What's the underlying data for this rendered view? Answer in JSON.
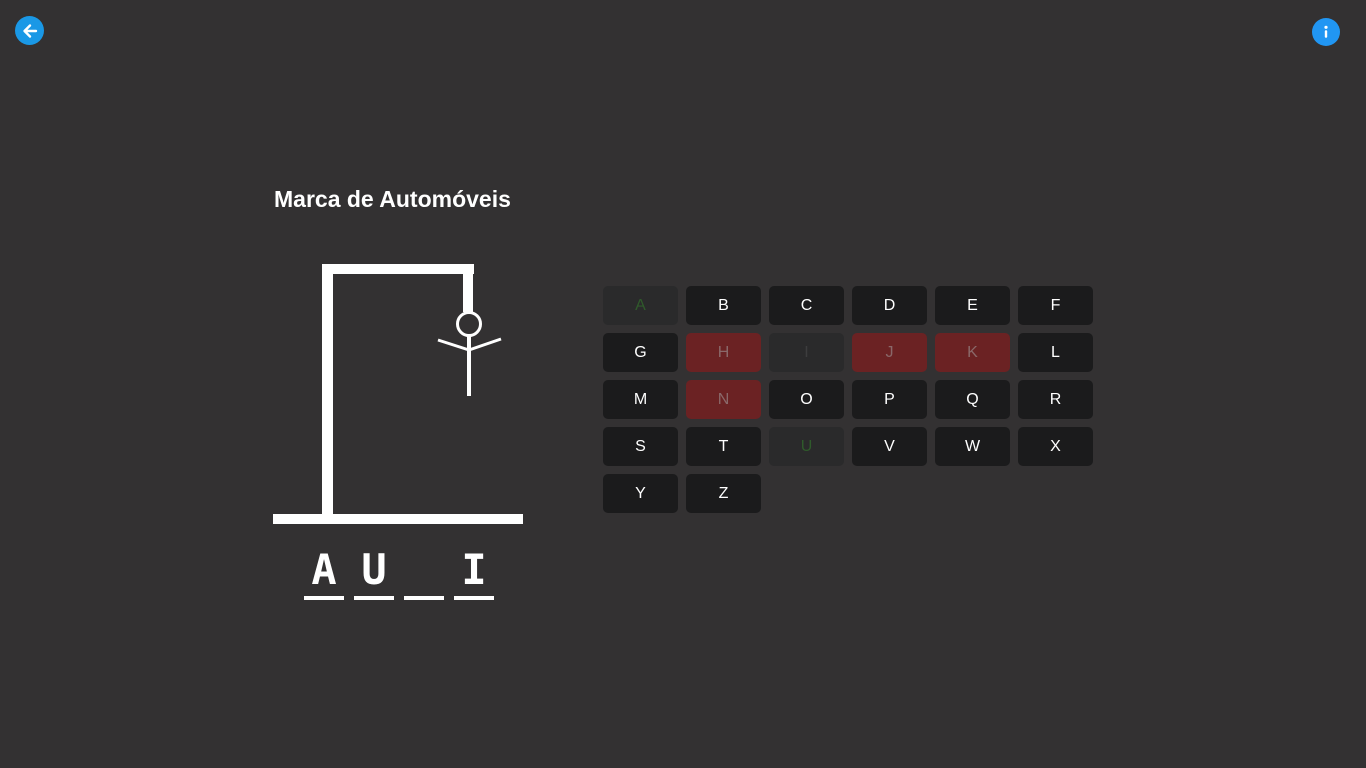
{
  "header": {
    "back_icon": "arrow-left-icon",
    "info_icon": "info-icon",
    "colors": {
      "back": "#1a98e6",
      "info": "#2196f3",
      "background": "#333132"
    }
  },
  "game": {
    "category": "Marca de Automóveis",
    "word_slots": [
      "A",
      "U",
      "",
      "I"
    ],
    "errors_shown": 5,
    "keyboard": [
      {
        "letter": "A",
        "state": "correct"
      },
      {
        "letter": "B",
        "state": "available"
      },
      {
        "letter": "C",
        "state": "available"
      },
      {
        "letter": "D",
        "state": "available"
      },
      {
        "letter": "E",
        "state": "available"
      },
      {
        "letter": "F",
        "state": "available"
      },
      {
        "letter": "G",
        "state": "available"
      },
      {
        "letter": "H",
        "state": "wrong"
      },
      {
        "letter": "I",
        "state": "used"
      },
      {
        "letter": "J",
        "state": "wrong"
      },
      {
        "letter": "K",
        "state": "wrong"
      },
      {
        "letter": "L",
        "state": "available"
      },
      {
        "letter": "M",
        "state": "available"
      },
      {
        "letter": "N",
        "state": "wrong"
      },
      {
        "letter": "O",
        "state": "available"
      },
      {
        "letter": "P",
        "state": "available"
      },
      {
        "letter": "Q",
        "state": "available"
      },
      {
        "letter": "R",
        "state": "available"
      },
      {
        "letter": "S",
        "state": "available"
      },
      {
        "letter": "T",
        "state": "available"
      },
      {
        "letter": "U",
        "state": "correct"
      },
      {
        "letter": "V",
        "state": "available"
      },
      {
        "letter": "W",
        "state": "available"
      },
      {
        "letter": "X",
        "state": "available"
      },
      {
        "letter": "Y",
        "state": "available"
      },
      {
        "letter": "Z",
        "state": "available"
      }
    ],
    "colors": {
      "key": "#1b1b1c",
      "key_correct_text": "#2f5a2b",
      "key_wrong_bg": "#6b2223"
    }
  }
}
